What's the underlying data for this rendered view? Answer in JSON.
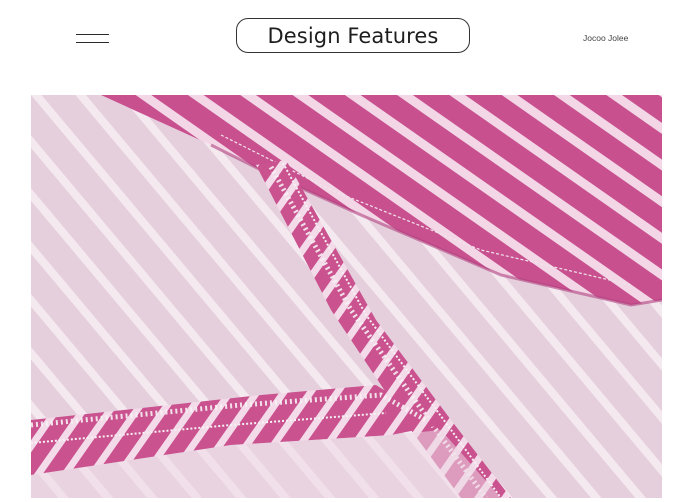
{
  "header": {
    "menu_icon": "menu-icon",
    "title": "Design Features",
    "brand": "Jocoo Jolee"
  },
  "photo": {
    "subject": "fabric-closeup",
    "colors": {
      "light_fabric": "#e8d1de",
      "light_stripe": "#f6eaf1",
      "pink_fabric": "#c94f92",
      "pink_stripe": "#f4d8e8",
      "stitch": "#f7f1f4"
    }
  }
}
